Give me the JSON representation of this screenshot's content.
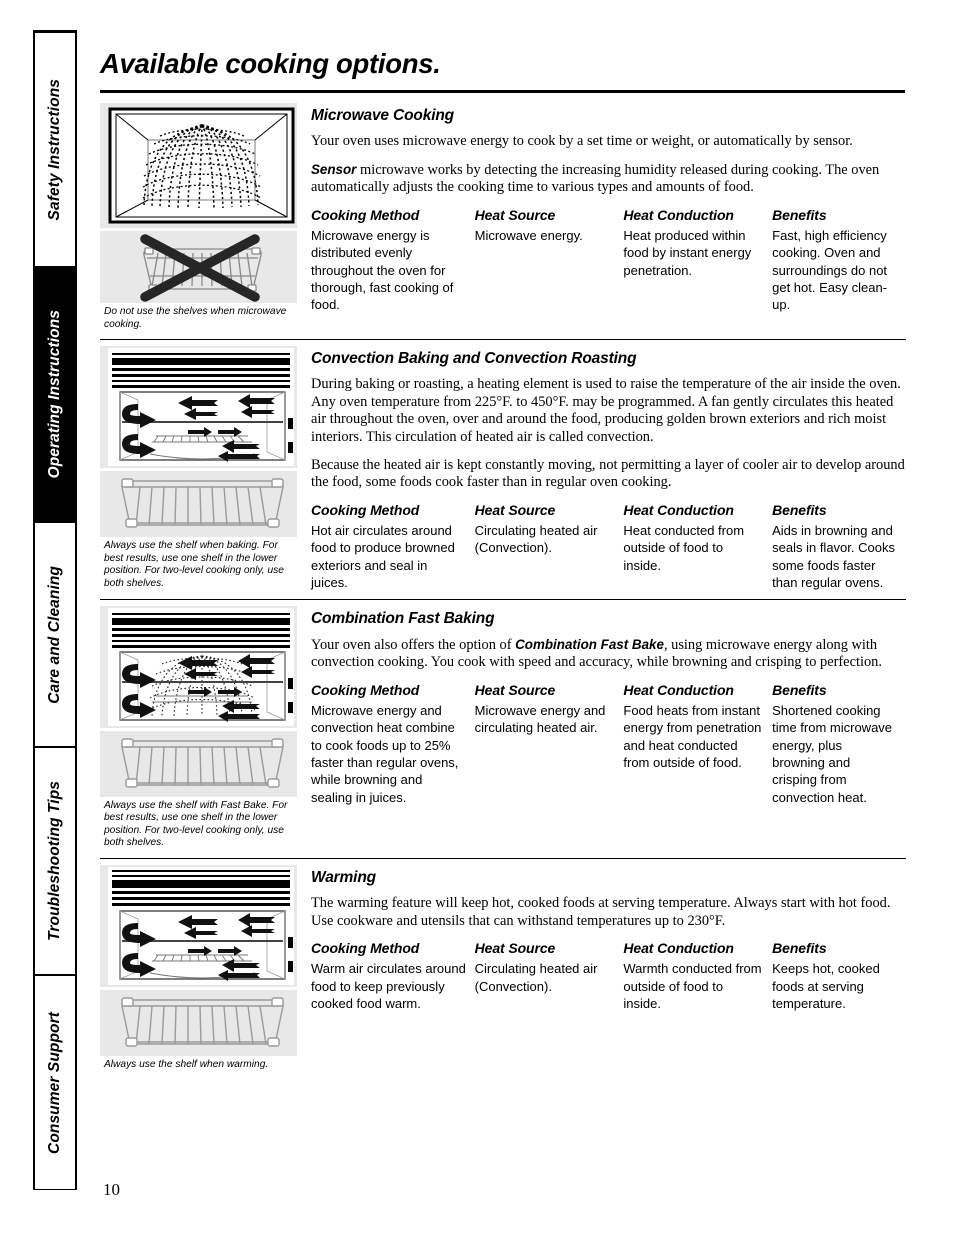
{
  "page": {
    "title": "Available cooking options.",
    "number": "10"
  },
  "sidebar": {
    "tabs": [
      {
        "label": "Safety Instructions",
        "active": false
      },
      {
        "label": "Operating Instructions",
        "active": true
      },
      {
        "label": "Care and Cleaning",
        "active": false
      },
      {
        "label": "Troubleshooting Tips",
        "active": false
      },
      {
        "label": "Consumer Support",
        "active": false
      }
    ]
  },
  "table_headers": {
    "c1": "Cooking Method",
    "c2": "Heat Source",
    "c3": "Heat Conduction",
    "c4": "Benefits"
  },
  "sections": [
    {
      "heading": "Microwave Cooking",
      "paragraphs": [
        "Your oven uses microwave energy to cook by a set time or weight, or automatically by sensor.",
        "Sensor microwave works by detecting the increasing humidity released during cooking. The oven automatically adjusts the cooking time to various types and amounts of food."
      ],
      "p2_lead": "Sensor",
      "p2_rest": " microwave works by detecting the increasing humidity released during cooking. The oven automatically adjusts the cooking time to various types and amounts of food.",
      "figures": [
        {
          "name": "microwave-energy-diagram",
          "caption": ""
        },
        {
          "name": "shelf-crossed-out-diagram",
          "caption": "Do not use the shelves when microwave cooking."
        }
      ],
      "row": {
        "c1": "Microwave energy is distributed evenly throughout the oven for thorough, fast cooking of food.",
        "c2": "Microwave energy.",
        "c3": "Heat produced within food by instant energy penetration.",
        "c4": "Fast, high efficiency cooking. Oven and surroundings do not get hot. Easy clean-up."
      }
    },
    {
      "heading": "Convection Baking and Convection Roasting",
      "paragraphs": [
        "During baking or roasting, a heating element is used to raise the temperature of the air inside the oven. Any oven temperature from 225°F. to 450°F. may be programmed. A fan gently circulates this heated air throughout the oven, over and around the food, producing golden brown exteriors and rich moist interiors. This circulation of heated air is called convection.",
        "Because the heated air is kept constantly moving, not permitting a layer of cooler air to develop around the food, some foods cook faster than in regular oven cooking."
      ],
      "figures": [
        {
          "name": "convection-airflow-diagram",
          "caption": ""
        },
        {
          "name": "oven-shelf-diagram",
          "caption": "Always use the shelf when baking. For best results, use one shelf in the lower position. For two-level cooking only, use both shelves."
        }
      ],
      "row": {
        "c1": "Hot air circulates around food to produce browned exteriors and seal in juices.",
        "c2": "Circulating heated air (Convection).",
        "c3": "Heat conducted from outside of food to inside.",
        "c4": "Aids in browning and seals in flavor. Cooks some foods faster than regular ovens."
      }
    },
    {
      "heading": "Combination Fast Baking",
      "paragraphs": [
        "Your oven also offers the option of Combination Fast Bake, using microwave energy along with convection cooking. You cook with speed and accuracy, while browning and crisping to perfection."
      ],
      "p1_pre": "Your oven also offers the option of ",
      "p1_bold": "Combination Fast Bake",
      "p1_post": ", using microwave energy along with convection cooking. You cook with speed and accuracy, while browning and crisping to perfection.",
      "figures": [
        {
          "name": "combination-fast-bake-diagram",
          "caption": ""
        },
        {
          "name": "oven-shelf-diagram",
          "caption": "Always use the shelf with Fast Bake. For best results, use one shelf in the lower position. For two-level cooking only, use both shelves."
        }
      ],
      "row": {
        "c1": "Microwave energy and convection heat combine to cook foods up to 25% faster than regular ovens, while browning and sealing in juices.",
        "c2": "Microwave energy and circulating heated air.",
        "c3": "Food heats from instant energy from penetration and heat conducted from outside of food.",
        "c4": "Shortened cooking time from microwave energy, plus browning and crisping from convection heat."
      }
    },
    {
      "heading": "Warming",
      "paragraphs": [
        "The warming feature will keep hot, cooked foods at serving temperature. Always start with hot food. Use cookware and utensils that can withstand temperatures up to 230°F."
      ],
      "figures": [
        {
          "name": "warming-airflow-diagram",
          "caption": ""
        },
        {
          "name": "oven-shelf-diagram",
          "caption": "Always use the shelf when warming."
        }
      ],
      "row": {
        "c1": "Warm air circulates around food to keep previously cooked food warm.",
        "c2": "Circulating heated air (Convection).",
        "c3": "Warmth conducted from outside of food to inside.",
        "c4": "Keeps hot, cooked foods at serving temperature."
      }
    }
  ]
}
